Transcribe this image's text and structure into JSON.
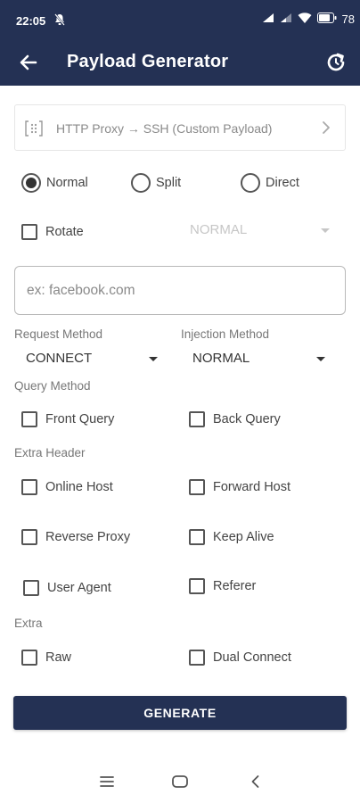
{
  "status_bar": {
    "time": "22:05",
    "battery": "78"
  },
  "app_bar": {
    "title": "Payload Generator"
  },
  "proxy_mode": {
    "label": "HTTP Proxy → SSH (Custom Payload)"
  },
  "split_mode": {
    "options": [
      "Normal",
      "Split",
      "Direct"
    ],
    "selected": "Normal"
  },
  "rotate": {
    "label": "Rotate",
    "checked": false,
    "dropdown_value": "NORMAL"
  },
  "host_input": {
    "value": "",
    "placeholder": "ex: facebook.com"
  },
  "request_method": {
    "label": "Request Method",
    "value": "CONNECT"
  },
  "injection_method": {
    "label": "Injection Method",
    "value": "NORMAL"
  },
  "query_method": {
    "label": "Query Method",
    "options": [
      {
        "label": "Front Query",
        "checked": false
      },
      {
        "label": "Back Query",
        "checked": false
      }
    ]
  },
  "extra_header": {
    "label": "Extra Header",
    "options": [
      {
        "label": "Online Host",
        "checked": false
      },
      {
        "label": "Forward Host",
        "checked": false
      },
      {
        "label": "Reverse Proxy",
        "checked": false
      },
      {
        "label": "Keep Alive",
        "checked": false
      },
      {
        "label": "User Agent",
        "checked": false
      },
      {
        "label": "Referer",
        "checked": false
      }
    ]
  },
  "extra": {
    "label": "Extra",
    "options": [
      {
        "label": "Raw",
        "checked": false
      },
      {
        "label": "Dual Connect",
        "checked": false
      }
    ]
  },
  "generate_button": {
    "label": "GENERATE"
  },
  "colors": {
    "primary": "#243154",
    "text": "#444444",
    "muted": "#777777",
    "disabled": "#c6c6c6"
  }
}
